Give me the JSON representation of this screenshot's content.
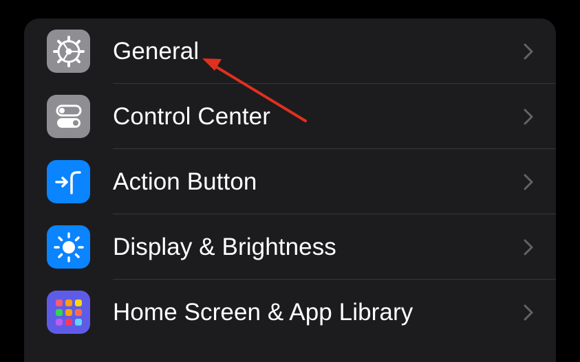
{
  "settings": {
    "items": [
      {
        "label": "General",
        "icon": "gear-icon",
        "icon_bg": "#8e8e93"
      },
      {
        "label": "Control Center",
        "icon": "toggles-icon",
        "icon_bg": "#8e8e93"
      },
      {
        "label": "Action Button",
        "icon": "action-button-icon",
        "icon_bg": "#0a84ff"
      },
      {
        "label": "Display & Brightness",
        "icon": "sun-icon",
        "icon_bg": "#0a84ff"
      },
      {
        "label": "Home Screen & App Library",
        "icon": "app-grid-icon",
        "icon_bg": "#5e5ce6"
      }
    ]
  },
  "annotation": {
    "arrow_color": "#e0301e",
    "points_to": "General"
  }
}
